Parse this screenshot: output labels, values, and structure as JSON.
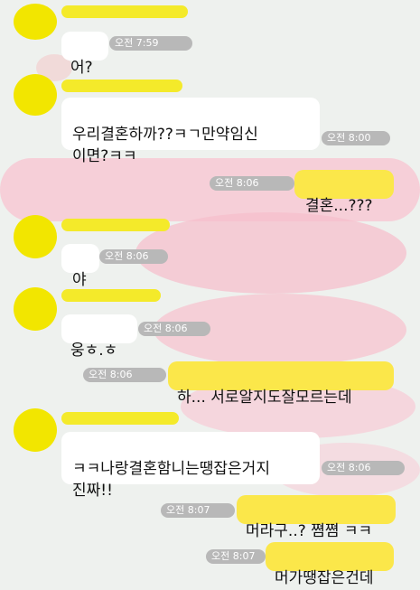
{
  "messages": [
    {
      "text": "어?",
      "time": "오전 7:59"
    },
    {
      "text": "우리결혼하까??ㅋㄱ만약임신\n이면?ㅋㅋ",
      "time": "오전 8:00"
    },
    {
      "text": "결혼...???",
      "time": "오전 8:06"
    },
    {
      "text": "야",
      "time": "오전 8:06"
    },
    {
      "text": "웅ㅎ.ㅎ",
      "time": "오전 8:06"
    },
    {
      "text": "하...  서로알지도잘모르는데",
      "time": "오전 8:06"
    },
    {
      "text": "ㅋㅋ나랑결혼함니는땡잡은거지\n진짜!!",
      "time": "오전 8:06"
    },
    {
      "text": "머라구..? 쪔쪔 ㅋㅋ",
      "time": "오전 8:07"
    },
    {
      "text": "머가땡잡은건데",
      "time": "오전 8:07"
    }
  ],
  "colors": {
    "background": "#eef1ee",
    "incoming_bubble": "#ffffff",
    "outgoing_bubble": "#fbe74a",
    "avatar_censor": "#f2e600",
    "scribble": "#f7c3cf",
    "timestamp_pill": "#b8b8b8"
  }
}
